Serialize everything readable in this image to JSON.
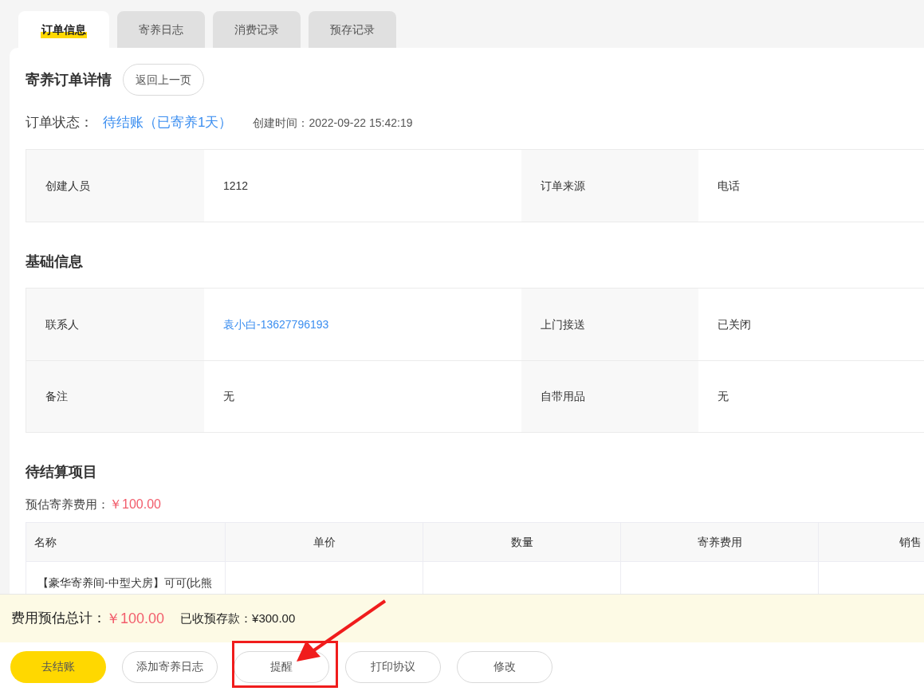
{
  "tabs": [
    {
      "label": "订单信息",
      "selected": true
    },
    {
      "label": "寄养日志",
      "selected": false
    },
    {
      "label": "消费记录",
      "selected": false
    },
    {
      "label": "预存记录",
      "selected": false
    }
  ],
  "header": {
    "title": "寄养订单详情",
    "back_button": "返回上一页"
  },
  "status": {
    "label": "订单状态：",
    "value": "待结账（已寄养1天）",
    "created": "创建时间：2022-09-22 15:42:19"
  },
  "order_info": [
    [
      {
        "label": "创建人员",
        "value": "1212",
        "link": false
      },
      {
        "label": "订单来源",
        "value": "电话",
        "link": false
      }
    ]
  ],
  "basic_section": {
    "title": "基础信息",
    "rows": [
      [
        {
          "label": "联系人",
          "value": "袁小白-13627796193",
          "link": true
        },
        {
          "label": "上门接送",
          "value": "已关闭",
          "link": false
        }
      ],
      [
        {
          "label": "备注",
          "value": "无",
          "link": false
        },
        {
          "label": "自带用品",
          "value": "无",
          "link": false
        }
      ]
    ]
  },
  "pending_section": {
    "title": "待结算项目",
    "estimate_label": "预估寄养费用：",
    "estimate_value": "￥100.00",
    "columns": [
      "名称",
      "单价",
      "数量",
      "寄养费用",
      "销售"
    ],
    "rows": [
      [
        "【豪华寄养间-中型犬房】可可(比熊"
      ]
    ]
  },
  "summary": {
    "total_label": "费用预估总计：",
    "total_value": "￥100.00",
    "deposit": "已收预存款：¥300.00"
  },
  "actions": [
    {
      "label": "去结账",
      "primary": true
    },
    {
      "label": "添加寄养日志",
      "primary": false
    },
    {
      "label": "提醒",
      "primary": false
    },
    {
      "label": "打印协议",
      "primary": false
    },
    {
      "label": "修改",
      "primary": false
    }
  ]
}
